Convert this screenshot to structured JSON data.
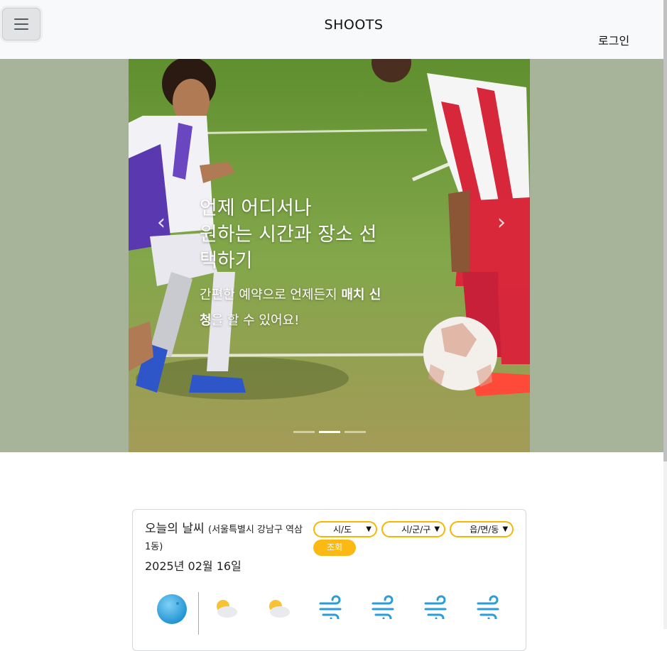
{
  "header": {
    "brand": "SHOOTS",
    "login_label": "로그인"
  },
  "hero": {
    "headline_line1": "언제 어디서나",
    "headline_line2": "원하는 시간과 장소 선택하기",
    "desc_prefix": "간편한 예약으로 언제든지 ",
    "desc_bold": "매치 신청",
    "desc_suffix": "을 할 수 있어요!",
    "prev_label": "‹",
    "next_label": "›",
    "slides_count": 3,
    "active_slide": 2
  },
  "weather": {
    "title": "오늘의 날씨",
    "location": "(서울특별시 강남구 역삼1동)",
    "date": "2025년 02월 16일",
    "selects": [
      "시/도",
      "시/군/구",
      "읍/면/동"
    ],
    "search_label": "조회",
    "icons": [
      "sphere-icon",
      "partly-cloudy-icon",
      "partly-cloudy-icon",
      "wind-icon",
      "wind-icon",
      "wind-icon",
      "wind-icon"
    ],
    "colors": {
      "accent": "#fdb913",
      "select_border": "#f5b800"
    }
  },
  "colors": {
    "header_bg": "#f8f9fa",
    "hero_bg": "#a7b49a"
  }
}
